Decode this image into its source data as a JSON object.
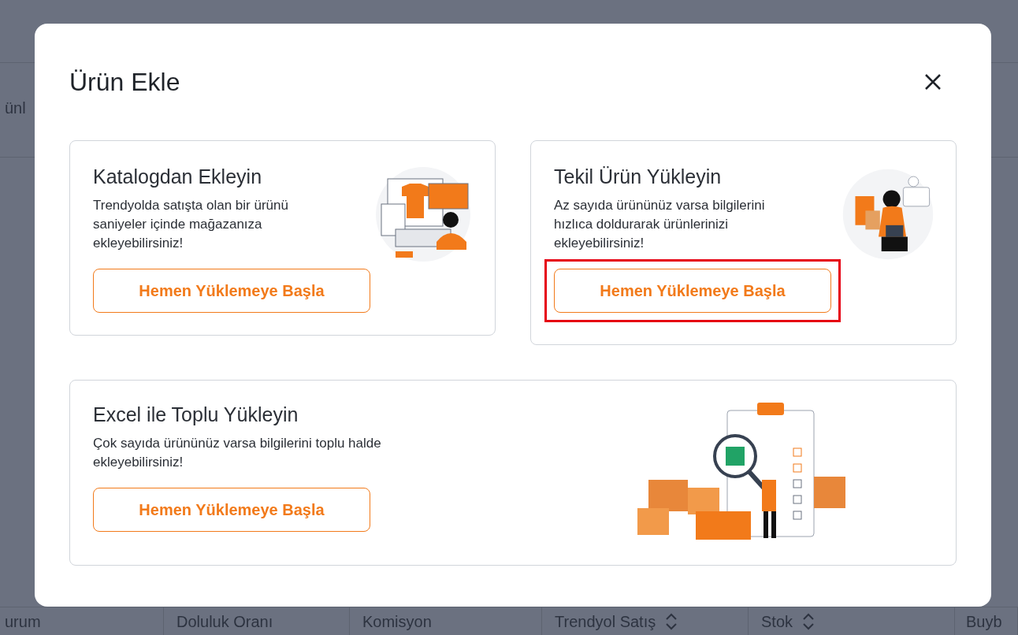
{
  "background": {
    "side_label": "ünl",
    "columns": [
      {
        "label": "urum",
        "sortable": false
      },
      {
        "label": "Doluluk Oranı",
        "sortable": false
      },
      {
        "label": "Komisyon",
        "sortable": false
      },
      {
        "label": "Trendyol Satış",
        "sortable": true
      },
      {
        "label": "Stok",
        "sortable": true
      },
      {
        "label": "Buyb",
        "sortable": false
      }
    ]
  },
  "dialog": {
    "title": "Ürün Ekle",
    "options": [
      {
        "kind": "catalog",
        "title": "Katalogdan Ekleyin",
        "description": "Trendyolda satışta olan bir ürünü saniyeler içinde mağazanıza ekleyebilirsiniz!",
        "button": "Hemen Yüklemeye Başla",
        "highlighted": false
      },
      {
        "kind": "single",
        "title": "Tekil Ürün Yükleyin",
        "description": "Az sayıda ürününüz varsa bilgilerini hızlıca doldurarak ürünlerinizi ekleyebilirsiniz!",
        "button": "Hemen Yüklemeye Başla",
        "highlighted": true
      },
      {
        "kind": "excel",
        "title": "Excel ile Toplu Yükleyin",
        "description": "Çok sayıda ürününüz varsa bilgilerini toplu halde ekleyebilirsiniz!",
        "button": "Hemen Yüklemeye Başla",
        "highlighted": false
      }
    ]
  }
}
